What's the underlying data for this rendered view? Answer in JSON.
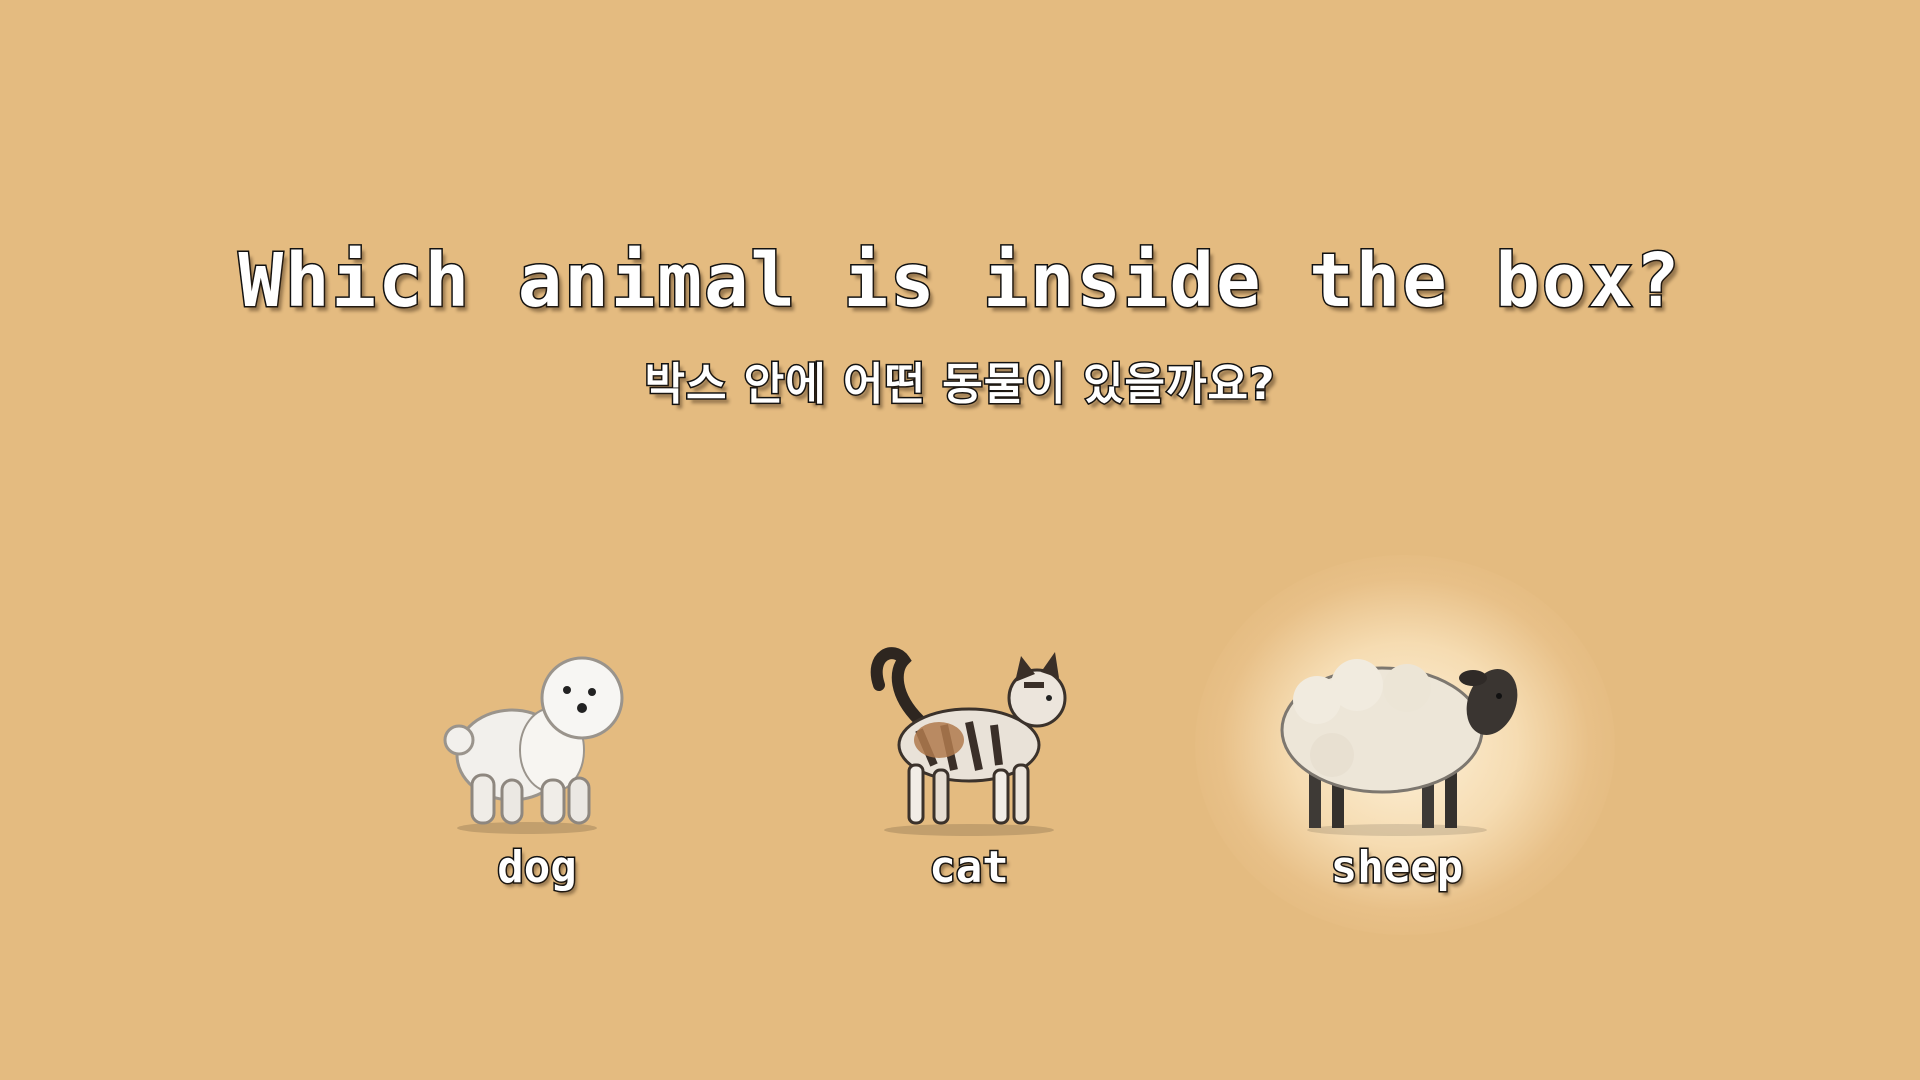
{
  "question": {
    "english": "Which animal is inside the box?",
    "korean": "박스 안에 어떤 동물이 있을까요?"
  },
  "choices": [
    {
      "label": "dog",
      "icon": "bichon-dog-icon",
      "selected": false
    },
    {
      "label": "cat",
      "icon": "calico-cat-icon",
      "selected": false
    },
    {
      "label": "sheep",
      "icon": "sheep-icon",
      "selected": true
    }
  ],
  "colors": {
    "background": "#e4bb80",
    "text_fill": "#ffffff",
    "text_outline": "#111111",
    "highlight_glow": "#fff4de"
  }
}
